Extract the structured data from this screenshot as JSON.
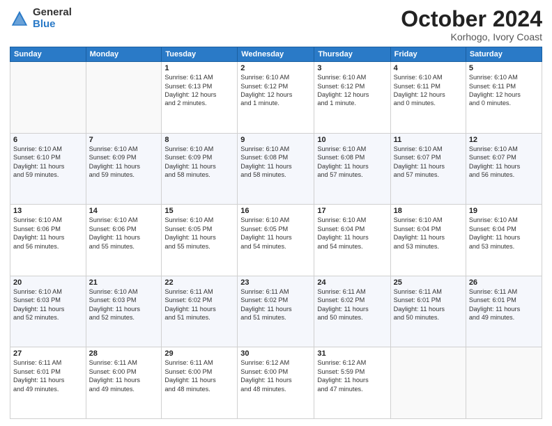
{
  "logo": {
    "general": "General",
    "blue": "Blue"
  },
  "title": "October 2024",
  "subtitle": "Korhogo, Ivory Coast",
  "days_header": [
    "Sunday",
    "Monday",
    "Tuesday",
    "Wednesday",
    "Thursday",
    "Friday",
    "Saturday"
  ],
  "weeks": [
    [
      {
        "day": "",
        "info": ""
      },
      {
        "day": "",
        "info": ""
      },
      {
        "day": "1",
        "info": "Sunrise: 6:11 AM\nSunset: 6:13 PM\nDaylight: 12 hours\nand 2 minutes."
      },
      {
        "day": "2",
        "info": "Sunrise: 6:10 AM\nSunset: 6:12 PM\nDaylight: 12 hours\nand 1 minute."
      },
      {
        "day": "3",
        "info": "Sunrise: 6:10 AM\nSunset: 6:12 PM\nDaylight: 12 hours\nand 1 minute."
      },
      {
        "day": "4",
        "info": "Sunrise: 6:10 AM\nSunset: 6:11 PM\nDaylight: 12 hours\nand 0 minutes."
      },
      {
        "day": "5",
        "info": "Sunrise: 6:10 AM\nSunset: 6:11 PM\nDaylight: 12 hours\nand 0 minutes."
      }
    ],
    [
      {
        "day": "6",
        "info": "Sunrise: 6:10 AM\nSunset: 6:10 PM\nDaylight: 11 hours\nand 59 minutes."
      },
      {
        "day": "7",
        "info": "Sunrise: 6:10 AM\nSunset: 6:09 PM\nDaylight: 11 hours\nand 59 minutes."
      },
      {
        "day": "8",
        "info": "Sunrise: 6:10 AM\nSunset: 6:09 PM\nDaylight: 11 hours\nand 58 minutes."
      },
      {
        "day": "9",
        "info": "Sunrise: 6:10 AM\nSunset: 6:08 PM\nDaylight: 11 hours\nand 58 minutes."
      },
      {
        "day": "10",
        "info": "Sunrise: 6:10 AM\nSunset: 6:08 PM\nDaylight: 11 hours\nand 57 minutes."
      },
      {
        "day": "11",
        "info": "Sunrise: 6:10 AM\nSunset: 6:07 PM\nDaylight: 11 hours\nand 57 minutes."
      },
      {
        "day": "12",
        "info": "Sunrise: 6:10 AM\nSunset: 6:07 PM\nDaylight: 11 hours\nand 56 minutes."
      }
    ],
    [
      {
        "day": "13",
        "info": "Sunrise: 6:10 AM\nSunset: 6:06 PM\nDaylight: 11 hours\nand 56 minutes."
      },
      {
        "day": "14",
        "info": "Sunrise: 6:10 AM\nSunset: 6:06 PM\nDaylight: 11 hours\nand 55 minutes."
      },
      {
        "day": "15",
        "info": "Sunrise: 6:10 AM\nSunset: 6:05 PM\nDaylight: 11 hours\nand 55 minutes."
      },
      {
        "day": "16",
        "info": "Sunrise: 6:10 AM\nSunset: 6:05 PM\nDaylight: 11 hours\nand 54 minutes."
      },
      {
        "day": "17",
        "info": "Sunrise: 6:10 AM\nSunset: 6:04 PM\nDaylight: 11 hours\nand 54 minutes."
      },
      {
        "day": "18",
        "info": "Sunrise: 6:10 AM\nSunset: 6:04 PM\nDaylight: 11 hours\nand 53 minutes."
      },
      {
        "day": "19",
        "info": "Sunrise: 6:10 AM\nSunset: 6:04 PM\nDaylight: 11 hours\nand 53 minutes."
      }
    ],
    [
      {
        "day": "20",
        "info": "Sunrise: 6:10 AM\nSunset: 6:03 PM\nDaylight: 11 hours\nand 52 minutes."
      },
      {
        "day": "21",
        "info": "Sunrise: 6:10 AM\nSunset: 6:03 PM\nDaylight: 11 hours\nand 52 minutes."
      },
      {
        "day": "22",
        "info": "Sunrise: 6:11 AM\nSunset: 6:02 PM\nDaylight: 11 hours\nand 51 minutes."
      },
      {
        "day": "23",
        "info": "Sunrise: 6:11 AM\nSunset: 6:02 PM\nDaylight: 11 hours\nand 51 minutes."
      },
      {
        "day": "24",
        "info": "Sunrise: 6:11 AM\nSunset: 6:02 PM\nDaylight: 11 hours\nand 50 minutes."
      },
      {
        "day": "25",
        "info": "Sunrise: 6:11 AM\nSunset: 6:01 PM\nDaylight: 11 hours\nand 50 minutes."
      },
      {
        "day": "26",
        "info": "Sunrise: 6:11 AM\nSunset: 6:01 PM\nDaylight: 11 hours\nand 49 minutes."
      }
    ],
    [
      {
        "day": "27",
        "info": "Sunrise: 6:11 AM\nSunset: 6:01 PM\nDaylight: 11 hours\nand 49 minutes."
      },
      {
        "day": "28",
        "info": "Sunrise: 6:11 AM\nSunset: 6:00 PM\nDaylight: 11 hours\nand 49 minutes."
      },
      {
        "day": "29",
        "info": "Sunrise: 6:11 AM\nSunset: 6:00 PM\nDaylight: 11 hours\nand 48 minutes."
      },
      {
        "day": "30",
        "info": "Sunrise: 6:12 AM\nSunset: 6:00 PM\nDaylight: 11 hours\nand 48 minutes."
      },
      {
        "day": "31",
        "info": "Sunrise: 6:12 AM\nSunset: 5:59 PM\nDaylight: 11 hours\nand 47 minutes."
      },
      {
        "day": "",
        "info": ""
      },
      {
        "day": "",
        "info": ""
      }
    ]
  ]
}
